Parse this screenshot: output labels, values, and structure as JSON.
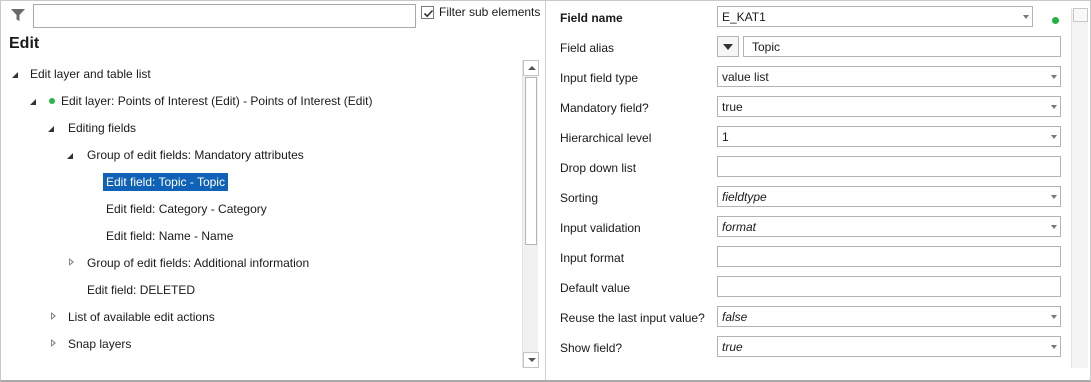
{
  "left_panel": {
    "filter": {
      "value": "",
      "placeholder": "",
      "checkbox_label": "Filter sub elements",
      "checkbox_checked": true
    },
    "title": "Edit",
    "tree": [
      {
        "label": "Edit layer and table list",
        "level": 0,
        "state": "expanded"
      },
      {
        "label": "Edit layer: Points of Interest (Edit) - Points of Interest (Edit)",
        "level": 1,
        "state": "expanded",
        "status": "active"
      },
      {
        "label": "Editing fields",
        "level": 2,
        "state": "expanded"
      },
      {
        "label": "Group of edit fields: Mandatory attributes",
        "level": 3,
        "state": "expanded"
      },
      {
        "label": "Edit field: Topic - Topic",
        "level": 4,
        "state": "leaf",
        "selected": true
      },
      {
        "label": "Edit field: Category - Category",
        "level": 4,
        "state": "leaf"
      },
      {
        "label": "Edit field: Name - Name",
        "level": 4,
        "state": "leaf"
      },
      {
        "label": "Group of edit fields: Additional information",
        "level": 3,
        "state": "collapsed"
      },
      {
        "label": "Edit field: DELETED",
        "level": 3,
        "state": "leaf"
      },
      {
        "label": "List of available edit actions",
        "level": 2,
        "state": "collapsed"
      },
      {
        "label": "Snap layers",
        "level": 2,
        "state": "collapsed"
      }
    ]
  },
  "properties": {
    "field_name": {
      "label": "Field name",
      "value": "E_KAT1",
      "status_color": "#1fb343"
    },
    "field_alias": {
      "label": "Field alias",
      "value": "Topic"
    },
    "input_field_type": {
      "label": "Input field type",
      "value": "value list"
    },
    "mandatory_field": {
      "label": "Mandatory field?",
      "value": "true"
    },
    "hierarchical_level": {
      "label": "Hierarchical level",
      "value": "1"
    },
    "drop_down_list": {
      "label": "Drop down list",
      "value": ""
    },
    "sorting": {
      "label": "Sorting",
      "value": "fieldtype"
    },
    "input_validation": {
      "label": "Input validation",
      "value": "format"
    },
    "input_format": {
      "label": "Input format",
      "value": ""
    },
    "default_value": {
      "label": "Default value",
      "value": ""
    },
    "reuse_last_input": {
      "label": "Reuse the last input value?",
      "value": "false"
    },
    "show_field": {
      "label": "Show field?",
      "value": "true"
    }
  },
  "colors": {
    "selection": "#0f62b5",
    "active_dot": "#2bb64a"
  }
}
